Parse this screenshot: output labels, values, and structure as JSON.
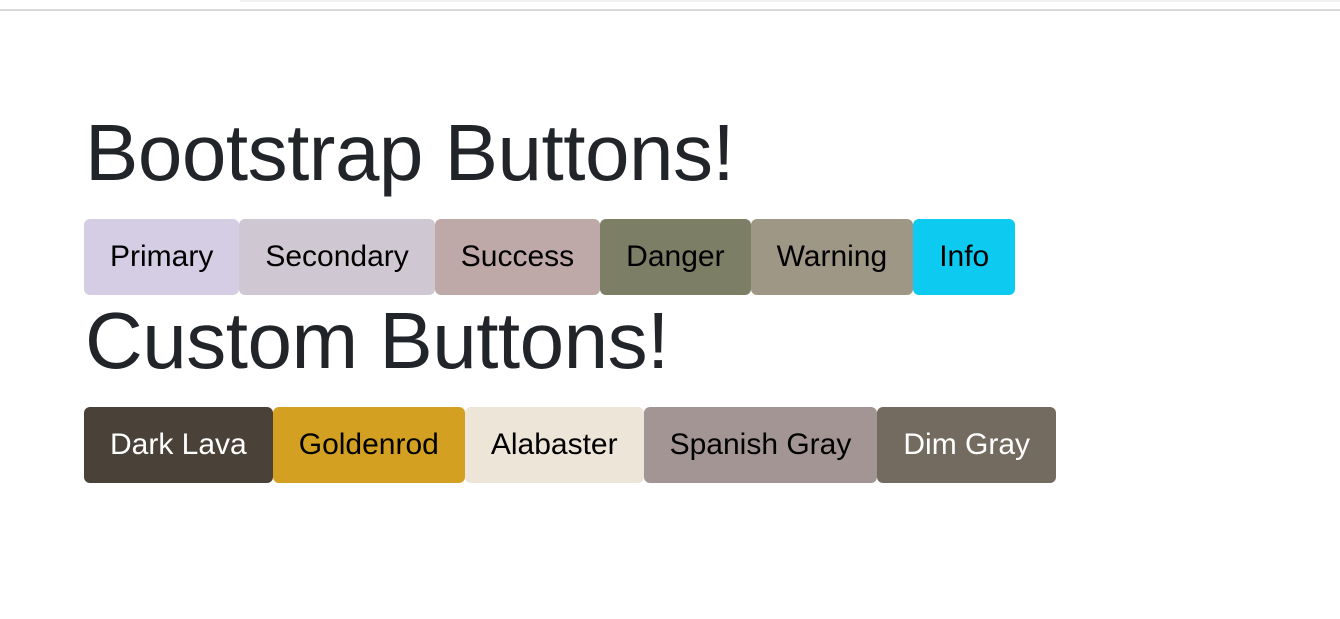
{
  "headings": {
    "bootstrap": "Bootstrap Buttons!",
    "custom": "Custom Buttons!"
  },
  "bootstrap_buttons": [
    {
      "label": "Primary",
      "color": "#d4cde3",
      "text_color": "#000000"
    },
    {
      "label": "Secondary",
      "color": "#cfc8d2",
      "text_color": "#000000"
    },
    {
      "label": "Success",
      "color": "#bea8a8",
      "text_color": "#000000"
    },
    {
      "label": "Danger",
      "color": "#7c7e66",
      "text_color": "#000000"
    },
    {
      "label": "Warning",
      "color": "#9e9785",
      "text_color": "#000000"
    },
    {
      "label": "Info",
      "color": "#0dcaf0",
      "text_color": "#000000"
    }
  ],
  "custom_buttons": [
    {
      "label": "Dark Lava",
      "color": "#4a4238",
      "text_color": "#ffffff"
    },
    {
      "label": "Goldenrod",
      "color": "#d4a021",
      "text_color": "#000000"
    },
    {
      "label": "Alabaster",
      "color": "#ede5d8",
      "text_color": "#000000"
    },
    {
      "label": "Spanish Gray",
      "color": "#a29594",
      "text_color": "#000000"
    },
    {
      "label": "Dim Gray",
      "color": "#746b60",
      "text_color": "#ffffff"
    }
  ]
}
